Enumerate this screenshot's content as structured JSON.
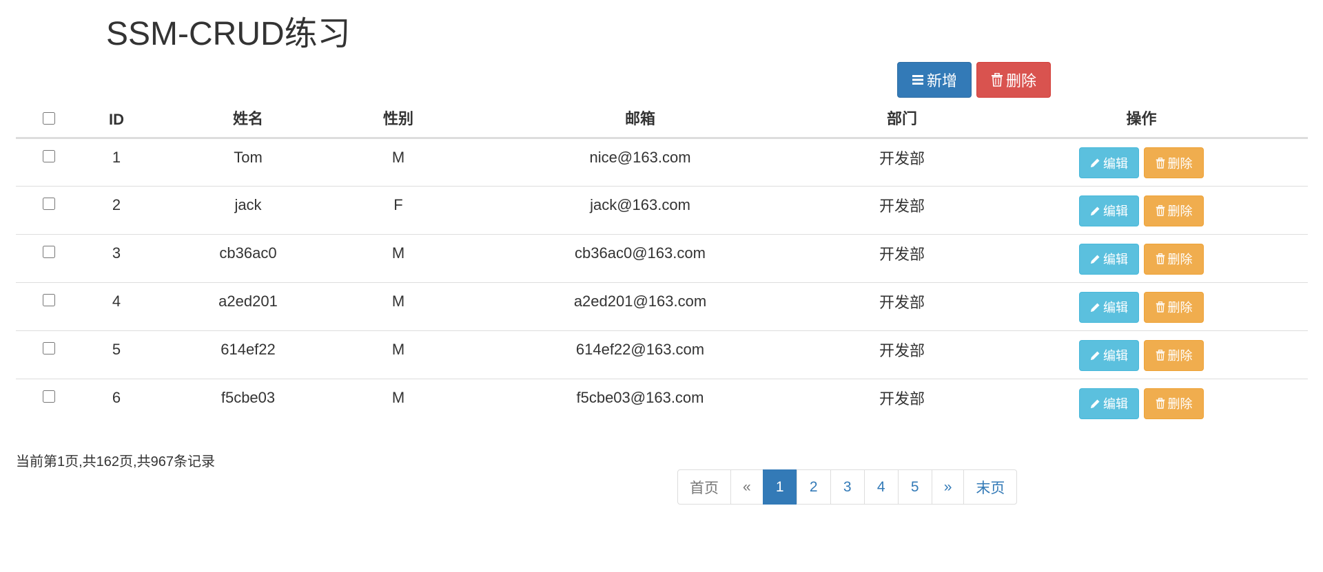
{
  "page": {
    "title": "SSM-CRUD练习"
  },
  "toolbar": {
    "add_label": "新增",
    "delete_label": "删除",
    "add_icon": "list-icon",
    "delete_icon": "trash-icon"
  },
  "table": {
    "columns": [
      "ID",
      "姓名",
      "性别",
      "邮箱",
      "部门",
      "操作"
    ],
    "rows": [
      {
        "id": "1",
        "name": "Tom",
        "gender": "M",
        "email": "nice@163.com",
        "dept": "开发部"
      },
      {
        "id": "2",
        "name": "jack",
        "gender": "F",
        "email": "jack@163.com",
        "dept": "开发部"
      },
      {
        "id": "3",
        "name": "cb36ac0",
        "gender": "M",
        "email": "cb36ac0@163.com",
        "dept": "开发部"
      },
      {
        "id": "4",
        "name": "a2ed201",
        "gender": "M",
        "email": "a2ed201@163.com",
        "dept": "开发部"
      },
      {
        "id": "5",
        "name": "614ef22",
        "gender": "M",
        "email": "614ef22@163.com",
        "dept": "开发部"
      },
      {
        "id": "6",
        "name": "f5cbe03",
        "gender": "M",
        "email": "f5cbe03@163.com",
        "dept": "开发部"
      }
    ],
    "edit_label": "编辑",
    "row_delete_label": "删除",
    "edit_icon": "pencil-icon",
    "row_delete_icon": "trash-icon"
  },
  "footer": {
    "page_info": "当前第1页,共162页,共967条记录"
  },
  "pagination": {
    "first": "首页",
    "prev": "«",
    "pages": [
      "1",
      "2",
      "3",
      "4",
      "5"
    ],
    "active_page": "1",
    "next": "»",
    "last": "末页"
  },
  "colors": {
    "primary": "#337ab7",
    "danger": "#d9534f",
    "info": "#5bc0de",
    "warning": "#f0ad4e",
    "border": "#dddddd"
  }
}
